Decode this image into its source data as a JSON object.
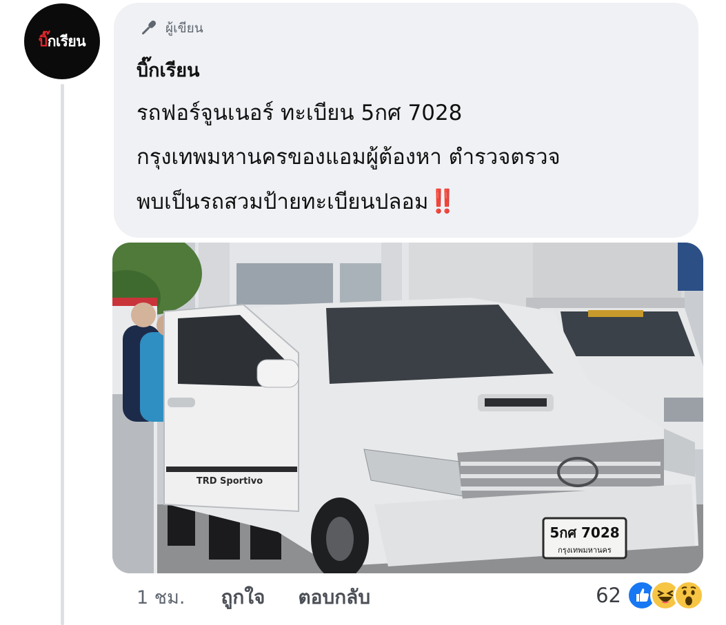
{
  "page": {
    "avatar_text_red": "บิ๊",
    "avatar_text_white": "กเรียน"
  },
  "comment": {
    "author_badge": "ผู้เขียน",
    "author_name": "บิ๊กเรียน",
    "text_lines": [
      "รถฟอร์จูนเนอร์ ทะเบียน 5กศ 7028",
      "กรุงเทพมหานครของแอมผู้ต้องหา ตำรวจตรวจ",
      "พบเป็นรถสวมป้ายทะเบียนปลอม"
    ],
    "emphasis": "‼️",
    "photo": {
      "plate_number": "5กศ 7028",
      "plate_province": "กรุงเทพมหานคร",
      "door_decal": "TRD Sportivo"
    }
  },
  "actions": {
    "time": "1 ชม.",
    "like": "ถูกใจ",
    "reply": "ตอบกลับ"
  },
  "reactions": {
    "count": "62",
    "icons": [
      "like-icon",
      "haha-icon",
      "wow-icon"
    ]
  },
  "colors": {
    "bubble_bg": "#eff1f4",
    "like_blue": "#1877f2",
    "emoji_yellow": "#f7c544",
    "alert_red": "#e01e1e"
  }
}
